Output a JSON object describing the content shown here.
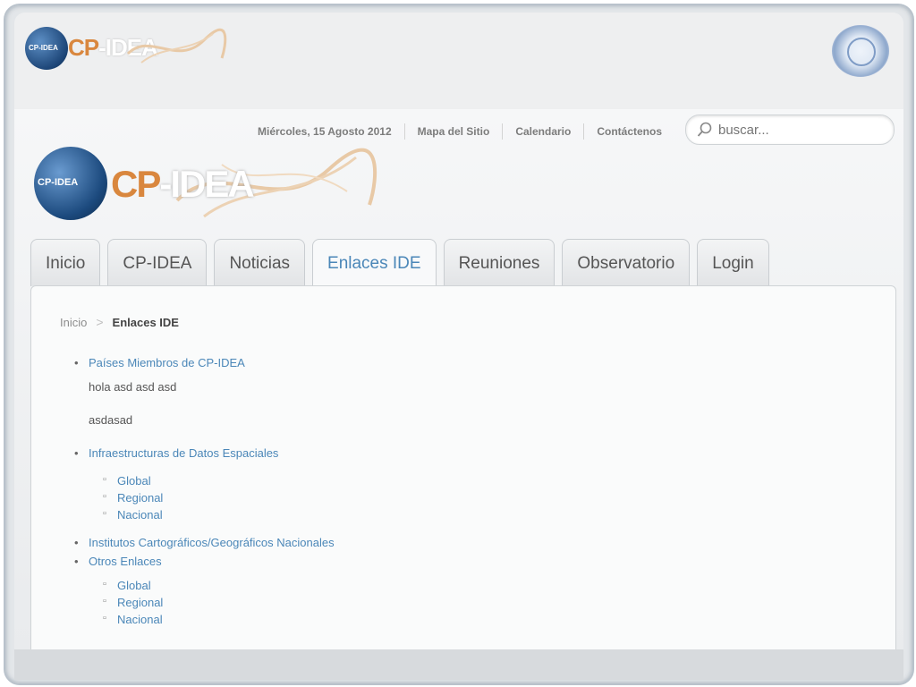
{
  "header": {
    "small_logo": {
      "cp": "CP",
      "idea": "-IDEA",
      "globe_text": "CP-IDEA"
    },
    "un_emblem_icon": "un-emblem-icon"
  },
  "utility_nav": {
    "date": "Miércoles, 15 Agosto 2012",
    "sitemap": "Mapa del Sitio",
    "calendar": "Calendario",
    "contact": "Contáctenos"
  },
  "search": {
    "placeholder": "buscar...",
    "icon": "search-icon"
  },
  "main_logo": {
    "cp": "CP",
    "idea": "-IDEA",
    "globe_text": "CP-IDEA"
  },
  "tabs": [
    {
      "label": "Inicio"
    },
    {
      "label": "CP-IDEA"
    },
    {
      "label": "Noticias"
    },
    {
      "label": "Enlaces IDE",
      "active": true
    },
    {
      "label": "Reuniones"
    },
    {
      "label": "Observatorio"
    },
    {
      "label": "Login"
    }
  ],
  "breadcrumb": {
    "home": "Inicio",
    "separator": ">",
    "current": "Enlaces IDE"
  },
  "content": {
    "items": [
      {
        "label": "Países Miembros de CP-IDEA",
        "paragraphs": [
          "hola asd asd asd",
          "asdasad"
        ]
      },
      {
        "label": "Infraestructuras de Datos Espaciales",
        "sub": [
          "Global",
          "Regional",
          "Nacional"
        ]
      },
      {
        "label": "Institutos Cartográficos/Geográficos Nacionales"
      },
      {
        "label": "Otros Enlaces",
        "sub": [
          "Global",
          "Regional",
          "Nacional"
        ]
      }
    ]
  },
  "colors": {
    "link": "#4b87b8",
    "accent_orange": "#d9873e",
    "globe_blue": "#1c4a7e"
  }
}
